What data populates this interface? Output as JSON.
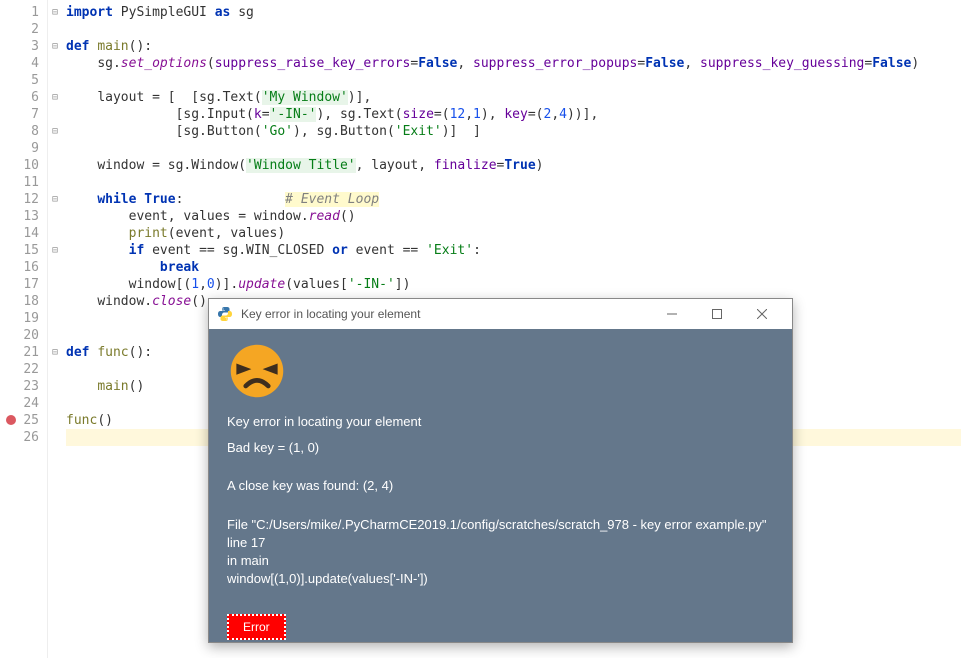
{
  "editor": {
    "lines": [
      {
        "n": 1,
        "fold": "-",
        "tokens": [
          [
            "kw",
            "import"
          ],
          [
            "ident",
            " PySimpleGUI "
          ],
          [
            "kw",
            "as"
          ],
          [
            "ident",
            " sg"
          ]
        ]
      },
      {
        "n": 2,
        "tokens": []
      },
      {
        "n": 3,
        "fold": "-",
        "tokens": [
          [
            "kw",
            "def "
          ],
          [
            "fn",
            "main"
          ],
          [
            "op",
            "():"
          ]
        ]
      },
      {
        "n": 4,
        "indent": 1,
        "tokens": [
          [
            "ident",
            "sg"
          ],
          [
            "op",
            "."
          ],
          [
            "meth",
            "set_options"
          ],
          [
            "op",
            "("
          ],
          [
            "param",
            "suppress_raise_key_errors"
          ],
          [
            "op",
            "="
          ],
          [
            "bool",
            "False"
          ],
          [
            "op",
            ", "
          ],
          [
            "param",
            "suppress_error_popups"
          ],
          [
            "op",
            "="
          ],
          [
            "bool",
            "False"
          ],
          [
            "op",
            ", "
          ],
          [
            "param",
            "suppress_key_guessing"
          ],
          [
            "op",
            "="
          ],
          [
            "bool",
            "False"
          ],
          [
            "op",
            ")"
          ]
        ]
      },
      {
        "n": 5,
        "tokens": []
      },
      {
        "n": 6,
        "indent": 1,
        "fold": "-",
        "tokens": [
          [
            "ident",
            "layout "
          ],
          [
            "op",
            "= [  [sg."
          ],
          [
            "cls",
            "Text"
          ],
          [
            "op",
            "("
          ],
          [
            "str-hl",
            "'My Window'"
          ],
          [
            "op",
            ")],"
          ]
        ]
      },
      {
        "n": 7,
        "indent": 1,
        "guide": 1,
        "tokens": [
          [
            "op",
            "          [sg."
          ],
          [
            "cls",
            "Input"
          ],
          [
            "op",
            "("
          ],
          [
            "param",
            "k"
          ],
          [
            "op",
            "="
          ],
          [
            "str-hl",
            "'-IN-'"
          ],
          [
            "op",
            "), sg."
          ],
          [
            "cls",
            "Text"
          ],
          [
            "op",
            "("
          ],
          [
            "param",
            "size"
          ],
          [
            "op",
            "=("
          ],
          [
            "num",
            "12"
          ],
          [
            "op",
            ","
          ],
          [
            "num",
            "1"
          ],
          [
            "op",
            "), "
          ],
          [
            "param",
            "key"
          ],
          [
            "op",
            "=("
          ],
          [
            "num",
            "2"
          ],
          [
            "op",
            ","
          ],
          [
            "num",
            "4"
          ],
          [
            "op",
            "))],"
          ]
        ]
      },
      {
        "n": 8,
        "indent": 1,
        "foldend": "-",
        "tokens": [
          [
            "op",
            "          [sg."
          ],
          [
            "cls",
            "Button"
          ],
          [
            "op",
            "("
          ],
          [
            "str",
            "'Go'"
          ],
          [
            "op",
            "), sg."
          ],
          [
            "cls",
            "Button"
          ],
          [
            "op",
            "("
          ],
          [
            "str",
            "'Exit'"
          ],
          [
            "op",
            ")]  ]"
          ]
        ]
      },
      {
        "n": 9,
        "tokens": []
      },
      {
        "n": 10,
        "indent": 1,
        "tokens": [
          [
            "ident",
            "window "
          ],
          [
            "op",
            "= sg."
          ],
          [
            "cls",
            "Window"
          ],
          [
            "op",
            "("
          ],
          [
            "str-hl",
            "'Window Title'"
          ],
          [
            "op",
            ", layout, "
          ],
          [
            "param",
            "finalize"
          ],
          [
            "op",
            "="
          ],
          [
            "bool",
            "True"
          ],
          [
            "op",
            ")"
          ]
        ]
      },
      {
        "n": 11,
        "tokens": []
      },
      {
        "n": 12,
        "indent": 1,
        "fold": "-",
        "tokens": [
          [
            "kw",
            "while "
          ],
          [
            "bool",
            "True"
          ],
          [
            "op",
            ":             "
          ],
          [
            "comment",
            "# Event Loop"
          ]
        ]
      },
      {
        "n": 13,
        "indent": 2,
        "tokens": [
          [
            "ident",
            "event"
          ],
          [
            "op",
            ", values = window."
          ],
          [
            "meth",
            "read"
          ],
          [
            "op",
            "()"
          ]
        ]
      },
      {
        "n": 14,
        "indent": 2,
        "tokens": [
          [
            "fn",
            "print"
          ],
          [
            "op",
            "(event, values)"
          ]
        ]
      },
      {
        "n": 15,
        "indent": 2,
        "fold": "-",
        "tokens": [
          [
            "kw",
            "if"
          ],
          [
            "ident",
            " event "
          ],
          [
            "op",
            "== sg."
          ],
          [
            "ident",
            "WIN_CLOSED"
          ],
          [
            "kw",
            " or "
          ],
          [
            "ident",
            "event "
          ],
          [
            "op",
            "== "
          ],
          [
            "str",
            "'Exit'"
          ],
          [
            "op",
            ":"
          ]
        ]
      },
      {
        "n": 16,
        "indent": 3,
        "tokens": [
          [
            "kw",
            "break"
          ]
        ]
      },
      {
        "n": 17,
        "indent": 2,
        "tokens": [
          [
            "ident",
            "window"
          ],
          [
            "op",
            "[("
          ],
          [
            "num",
            "1"
          ],
          [
            "op",
            ","
          ],
          [
            "num",
            "0"
          ],
          [
            "op",
            ")]."
          ],
          [
            "meth",
            "update"
          ],
          [
            "op",
            "(values["
          ],
          [
            "str",
            "'-IN-'"
          ],
          [
            "op",
            "])"
          ]
        ]
      },
      {
        "n": 18,
        "indent": 1,
        "tokens": [
          [
            "ident",
            "window"
          ],
          [
            "op",
            "."
          ],
          [
            "meth",
            "close"
          ],
          [
            "op",
            "()"
          ]
        ]
      },
      {
        "n": 19,
        "tokens": []
      },
      {
        "n": 20,
        "tokens": []
      },
      {
        "n": 21,
        "fold": "-",
        "tokens": [
          [
            "kw",
            "def "
          ],
          [
            "fn",
            "func"
          ],
          [
            "op",
            "():"
          ]
        ]
      },
      {
        "n": 22,
        "tokens": []
      },
      {
        "n": 23,
        "indent": 1,
        "tokens": [
          [
            "fn",
            "main"
          ],
          [
            "op",
            "()"
          ]
        ]
      },
      {
        "n": 24,
        "tokens": []
      },
      {
        "n": 25,
        "breakpoint": true,
        "tokens": [
          [
            "fn",
            "func"
          ],
          [
            "op",
            "()"
          ]
        ]
      },
      {
        "n": 26,
        "hl": true,
        "tokens": []
      }
    ]
  },
  "dialog": {
    "title": "Key error in locating your element",
    "msg1": "Key error in locating your element",
    "msg2": "Bad key = (1, 0)",
    "msg3": "A close key was found: (2, 4)",
    "file": "  File \"C:/Users/mike/.PyCharmCE2019.1/config/scratches/scratch_978 - key error example.py\"",
    "line": "line 17",
    "infunc": "in main",
    "code": "    window[(1,0)].update(values['-IN-'])",
    "button": "Error"
  }
}
